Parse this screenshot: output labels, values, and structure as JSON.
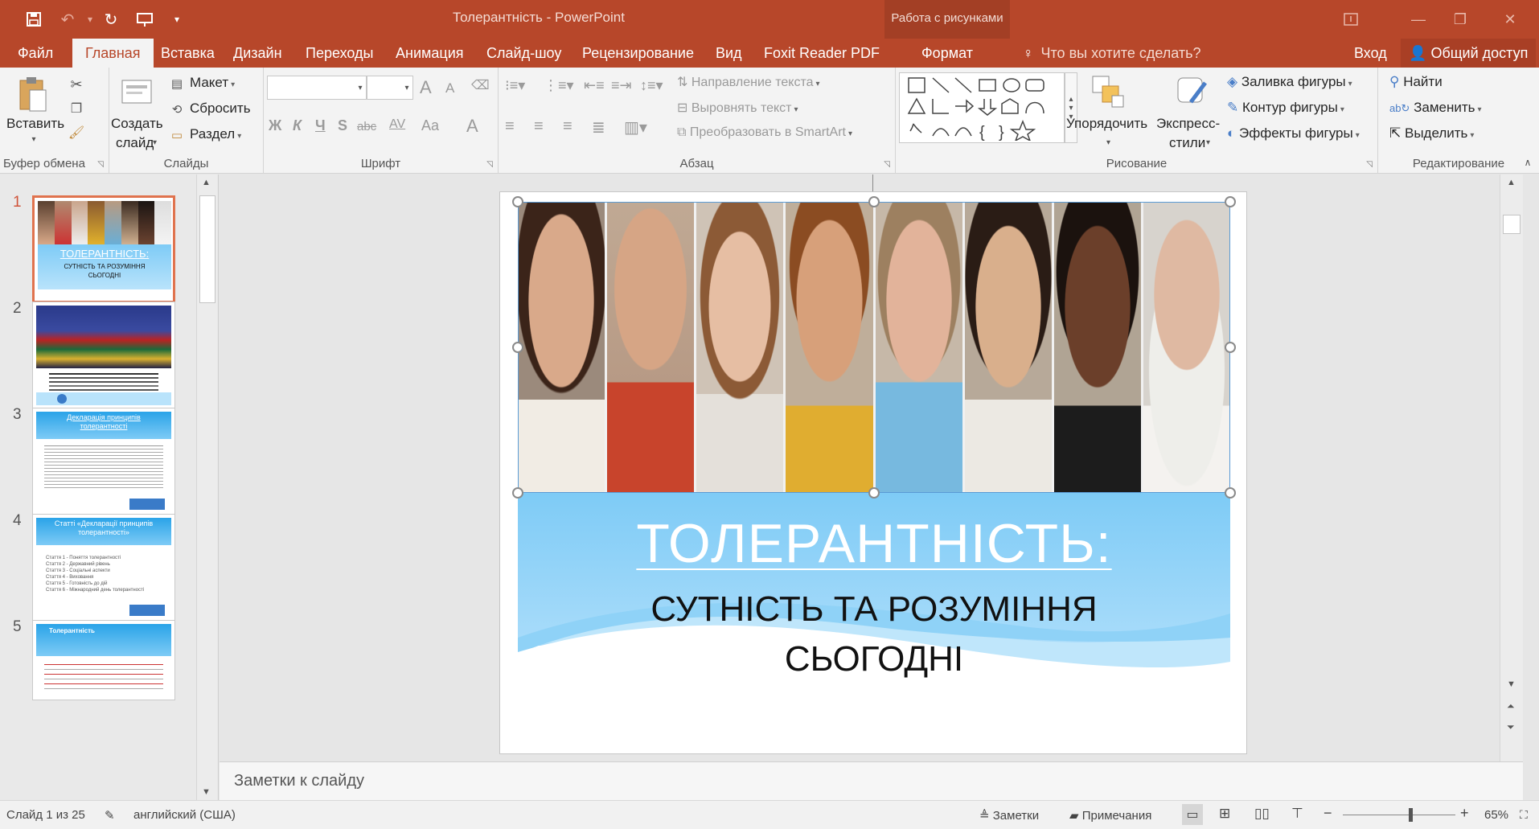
{
  "window": {
    "title": "Толерантність - PowerPoint",
    "context_title": "Работа с рисунками"
  },
  "qat": {
    "save_icon": "save-icon",
    "undo_icon": "undo-icon",
    "redo_icon": "redo-icon",
    "present_icon": "present-icon",
    "customize_icon": "chevron-down-icon"
  },
  "tabs": [
    "Файл",
    "Главная",
    "Вставка",
    "Дизайн",
    "Переходы",
    "Анимация",
    "Слайд-шоу",
    "Рецензирование",
    "Вид",
    "Foxit Reader PDF",
    "Формат"
  ],
  "tell_me": "Что вы хотите сделать?",
  "signin": "Вход",
  "share": "Общий доступ",
  "ribbon": {
    "clipboard": {
      "paste": "Вставить",
      "label": "Буфер обмена"
    },
    "slides": {
      "new_slide_1": "Создать",
      "new_slide_2": "слайд",
      "layout": "Макет",
      "reset": "Сбросить",
      "section": "Раздел",
      "label": "Слайды"
    },
    "font": {
      "bold": "Ж",
      "italic": "К",
      "underline": "Ч",
      "shadow": "S",
      "strike": "abc",
      "spacing": "AV",
      "case": "Aa",
      "color": "A",
      "grow": "A",
      "shrink": "A",
      "label": "Шрифт"
    },
    "paragraph": {
      "text_direction": "Направление текста",
      "align_text": "Выровнять текст",
      "smartart": "Преобразовать в SmartArt",
      "label": "Абзац"
    },
    "drawing": {
      "arrange": "Упорядочить",
      "quick_styles_1": "Экспресс-",
      "quick_styles_2": "стили",
      "fill": "Заливка фигуры",
      "outline": "Контур фигуры",
      "effects": "Эффекты фигуры",
      "label": "Рисование"
    },
    "editing": {
      "find": "Найти",
      "replace": "Заменить",
      "select": "Выделить",
      "label": "Редактирование"
    }
  },
  "thumbnails": [
    {
      "num": "1",
      "title": "ТОЛЕРАНТНІСТЬ:",
      "subtitle": "СУТНІСТЬ ТА РОЗУМІННЯ СЬОГОДНІ"
    },
    {
      "num": "2"
    },
    {
      "num": "3",
      "title": "Декларація принципів толерантності"
    },
    {
      "num": "4",
      "title": "Статті «Декларації принципів толерантності»",
      "items": [
        "Стаття 1 - Поняття толерантності",
        "Стаття 2 - Державний рівень",
        "Стаття 3 - Соціальні аспекти",
        "Стаття 4 - Виховання",
        "Стаття 5 - Готовність до дій",
        "Стаття 6 - Міжнародний день толерантності"
      ]
    },
    {
      "num": "5",
      "title": "Толерантність"
    }
  ],
  "slide": {
    "title": "ТОЛЕРАНТНІСТЬ:",
    "subtitle_line1": "СУТНІСТЬ ТА РОЗУМІННЯ",
    "subtitle_line2": "СЬОГОДНІ"
  },
  "notes_placeholder": "Заметки к слайду",
  "status": {
    "slide_of": "Слайд 1 из 25",
    "language": "английский (США)",
    "notes": "Заметки",
    "comments": "Примечания",
    "zoom": "65%",
    "zoom_fraction": 0.6
  },
  "colors": {
    "accent": "#b7472a",
    "slide_blue": "#7ecbf6"
  }
}
